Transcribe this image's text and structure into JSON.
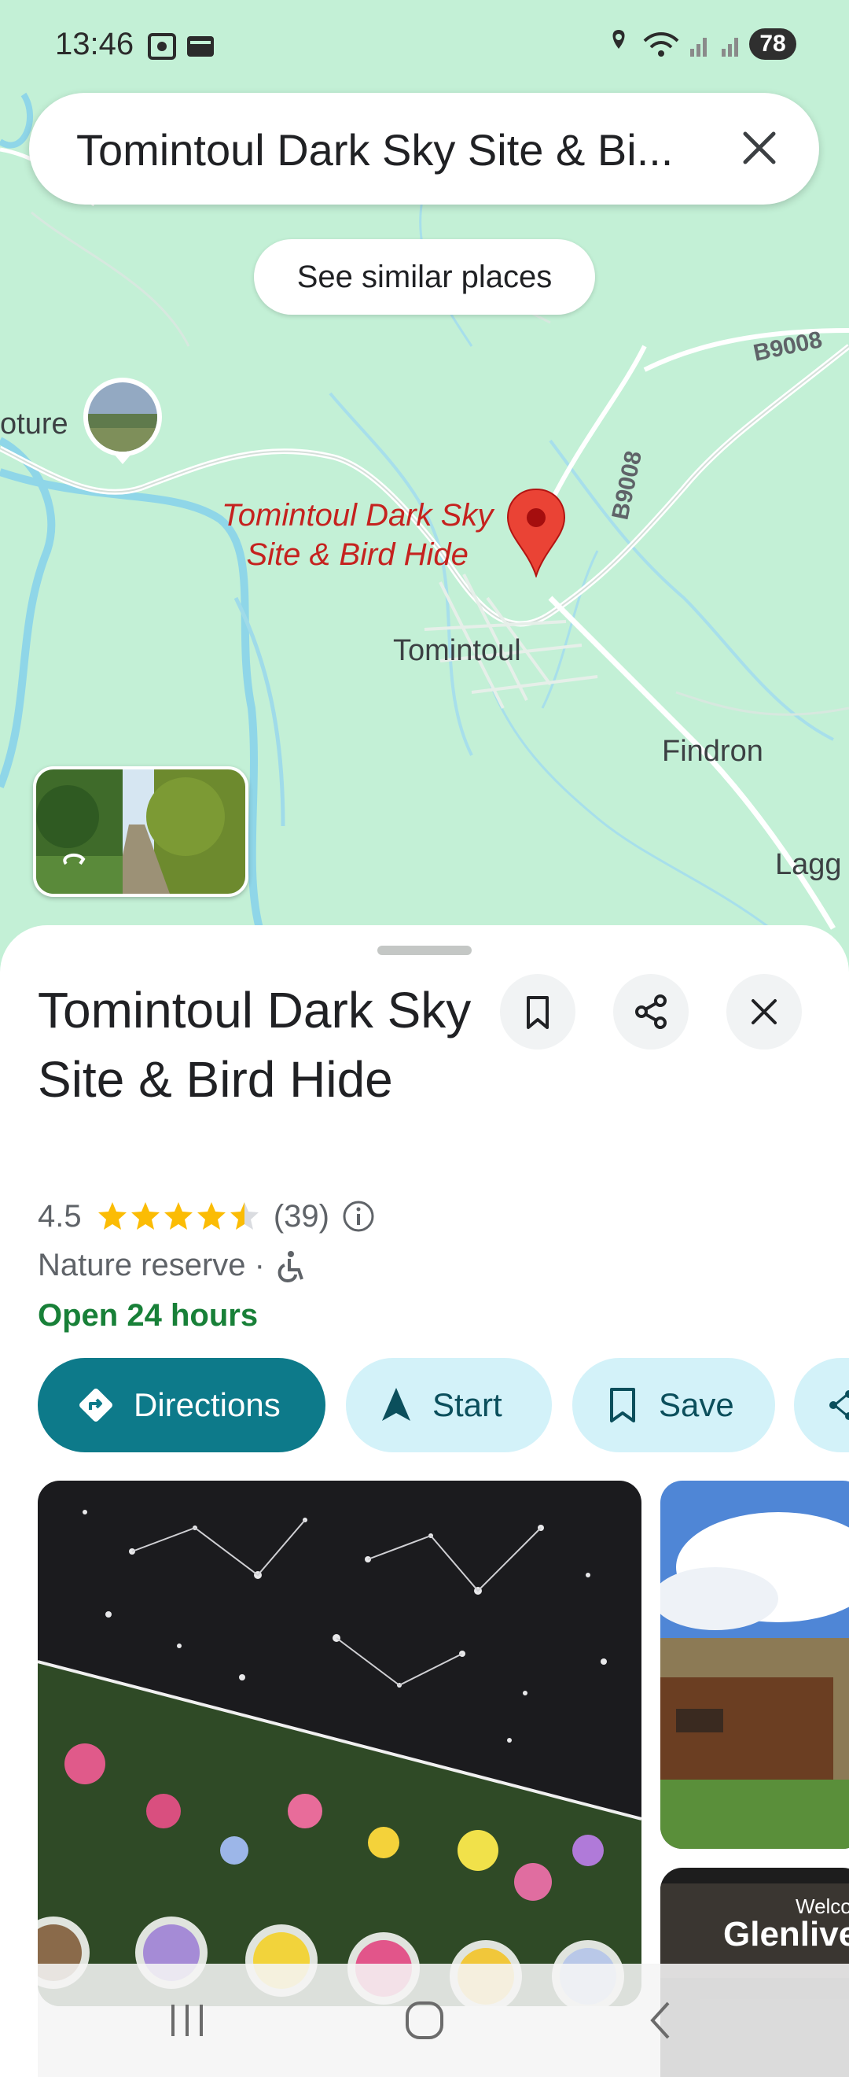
{
  "status_bar": {
    "time": "13:46",
    "battery": "78",
    "icons": [
      "screenshot-icon",
      "wallet-icon",
      "location-icon",
      "wifi-icon",
      "signal-icon",
      "signal-icon"
    ]
  },
  "search": {
    "value": "Tomintoul Dark Sky Site & Bi..."
  },
  "map": {
    "similar_places_label": "See similar places",
    "labels": {
      "left_fragment": "oture",
      "town": "Tomintoul",
      "findron": "Findron",
      "lagg": "Lagg"
    },
    "roads": {
      "b9008_east": "B9008",
      "b9008_north": "B9008"
    },
    "marker": {
      "line1": "Tomintoul Dark Sky",
      "line2": "Site & Bird Hide",
      "color": "#ea4335"
    }
  },
  "place": {
    "title": "Tomintoul Dark Sky Site & Bird Hide",
    "rating": "4.5",
    "rating_stars": 4.5,
    "review_count": "(39)",
    "category": "Nature reserve ·",
    "hours": "Open 24 hours"
  },
  "actions": {
    "directions": "Directions",
    "start": "Start",
    "save": "Save"
  },
  "photos": {
    "side_caption_1": "Welco",
    "side_caption_2": "Glenlive"
  },
  "colors": {
    "map_bg": "#c3f0d6",
    "primary": "#0d7a8a",
    "chip_bg": "#d3f2f9",
    "open_green": "#188038",
    "star": "#fbbc04"
  }
}
